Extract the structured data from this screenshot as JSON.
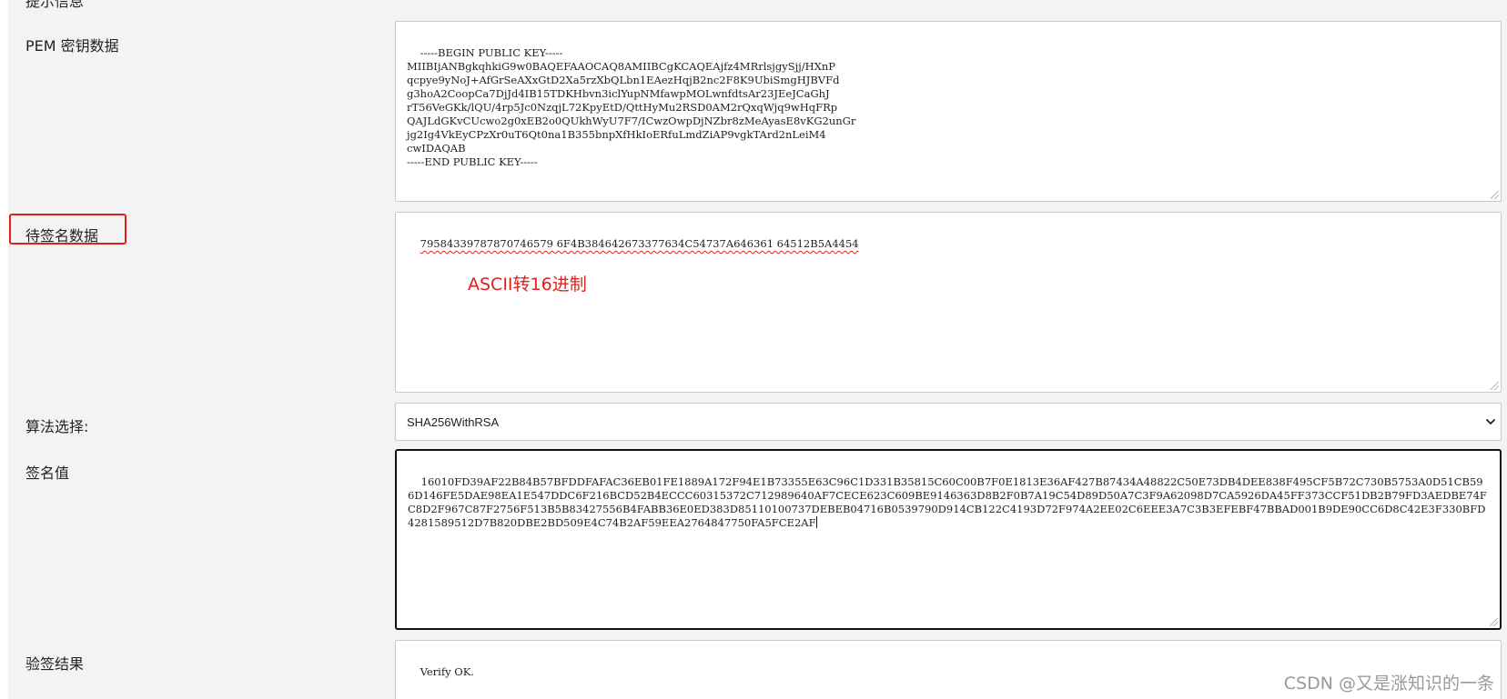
{
  "form": {
    "clipped_top_label": "提示信息",
    "pem": {
      "label": "PEM 密钥数据",
      "value": "-----BEGIN PUBLIC KEY-----\nMIIBIjANBgkqhkiG9w0BAQEFAAOCAQ8AMIIBCgKCAQEAjfz4MRrlsjgySjj/HXnP\nqcpye9yNoJ+AfGrSeAXxGtD2Xa5rzXbQLbn1EAezHqjB2nc2F8K9UbiSmgHJBVFd\ng3hoA2CoopCa7DjJd4IB15TDKHbvn3iclYupNMfawpMOLwnfdtsAr23JEeJCaGhJ\nrT56VeGKk/lQU/4rp5Jc0NzqjL72KpyEtD/QttHyMu2RSD0AM2rQxqWjq9wHqFRp\nQAJLdGKvCUcwo2g0xEB2o0QUkhWyU7F7/ICwzOwpDjNZbr8zMeAyasE8vKG2unGr\njg2Ig4VkEyCPzXr0uT6Qt0na1B355bnpXfHkIoERfuLmdZiAP9vgkTArd2nLeiM4\ncwIDAQAB\n-----END PUBLIC KEY-----"
    },
    "data_to_sign": {
      "label": "待签名数据",
      "value": "79584339787870746579 6F4B384642673377634C54737A646361 64512B5A4454"
    },
    "annotation": "ASCII转16进制",
    "algorithm": {
      "label": "算法选择:",
      "selected": "SHA256WithRSA"
    },
    "signature": {
      "label": "签名值",
      "value": "16010FD39AF22B84B57BFDDFAFAC36EB01FE1889A172F94E1B73355E63C96C1D331B35815C60C00B7F0E1813E36AF427B87434A48822C50E73DB4DEE838F495CF5B72C730B5753A0D51CB596D146FE5DAE98EA1E547DDC6F216BCD52B4ECCC60315372C712989640AF7CECE623C609BE9146363D8B2F0B7A19C54D89D50A7C3F9A62098D7CA5926DA45FF373CCF51DB2B79FD3AEDBE74FC8D2F967C87F2756F513B5B83427556B4FABB36E0ED383D85110100737DEBEB04716B0539790D914CB122C4193D72F974A2EE02C6EEE3A7C3B3EFEBF47BBAD001B9DE90CC6D8C42E3F330BFD4281589512D7B820DBE2BD509E4C74B2AF59EEA2764847750FA5FCE2AF"
    },
    "verify": {
      "label": "验签结果",
      "value": "Verify OK."
    }
  },
  "watermark": "CSDN @又是涨知识的一条",
  "colors": {
    "annotation_red": "#e0201e",
    "background": "#f3f3f3",
    "box_border": "#c8c8c8"
  },
  "icons": {
    "select_arrow": "chevron-down-icon",
    "resize": "resize-grip-icon"
  }
}
